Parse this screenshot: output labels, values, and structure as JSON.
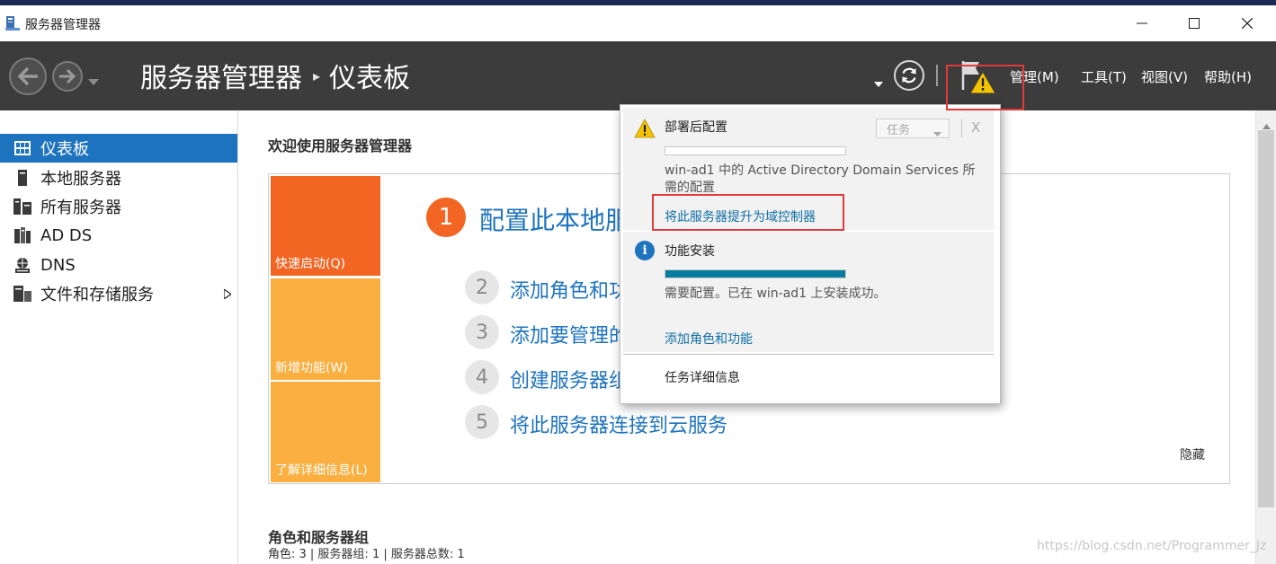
{
  "window": {
    "title": "服务器管理器",
    "controls": {
      "minimize": "minimize",
      "maximize": "maximize",
      "close": "close"
    }
  },
  "header": {
    "breadcrumb": [
      "服务器管理器",
      "仪表板"
    ],
    "menus": [
      "管理(M)",
      "工具(T)",
      "视图(V)",
      "帮助(H)"
    ]
  },
  "sidebar": {
    "items": [
      {
        "label": "仪表板",
        "icon": "dashboard-icon",
        "active": true
      },
      {
        "label": "本地服务器",
        "icon": "server-icon"
      },
      {
        "label": "所有服务器",
        "icon": "servers-icon"
      },
      {
        "label": "AD DS",
        "icon": "ad-ds-icon"
      },
      {
        "label": "DNS",
        "icon": "dns-icon"
      },
      {
        "label": "文件和存储服务",
        "icon": "file-storage-icon",
        "has_arrow": true
      }
    ]
  },
  "main": {
    "welcome": "欢迎使用服务器管理器",
    "tiles": [
      "快速启动(Q)",
      "新增功能(W)",
      "了解详细信息(L)"
    ],
    "step1": {
      "number": "1",
      "label": "配置此本地服务器"
    },
    "steps": [
      {
        "number": "2",
        "label": "添加角色和功能"
      },
      {
        "number": "3",
        "label": "添加要管理的其他服务器"
      },
      {
        "number": "4",
        "label": "创建服务器组"
      },
      {
        "number": "5",
        "label": "将此服务器连接到云服务"
      }
    ],
    "hide": "隐藏",
    "roles_title": "角色和服务器组",
    "roles_summary": "角色: 3 | 服务器组: 1 | 服务器总数: 1"
  },
  "notifications": {
    "post_deploy": {
      "title": "部署后配置",
      "task_button": "任务",
      "close": "X",
      "progress": 0,
      "description": "win-ad1 中的 Active Directory Domain Services 所需的配置",
      "link": "将此服务器提升为域控制器"
    },
    "feature_install": {
      "title": "功能安装",
      "progress": 1,
      "description": "需要配置。已在 win-ad1 上安装成功。",
      "link": "添加角色和功能"
    },
    "task_details": "任务详细信息"
  },
  "watermark": "https://blog.csdn.net/Programmer_Jz",
  "colors": {
    "header_bg": "#3c3c3c",
    "active_item": "#1e73be",
    "tile_orange": "#f26522",
    "tile_light_orange": "#faaf40",
    "link_blue": "#1e73be",
    "progress_fill": "#087c9e",
    "highlight_red": "#e23a3a"
  }
}
